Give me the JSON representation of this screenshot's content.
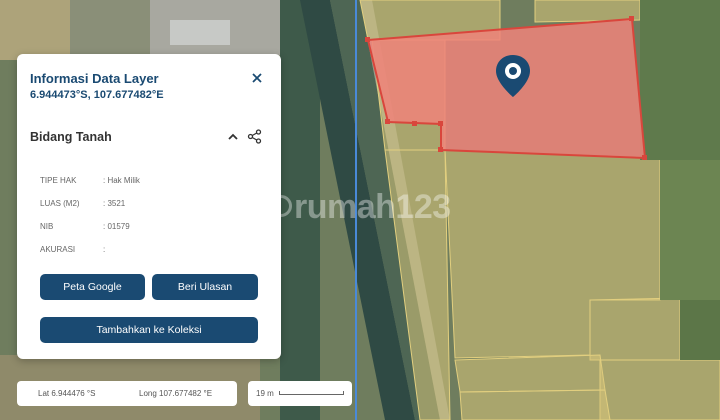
{
  "map": {
    "watermark": "rumah123"
  },
  "panel": {
    "title": "Informasi Data Layer",
    "coordinates": "6.944473°S, 107.677482°E",
    "section_title": "Bidang Tanah",
    "rows": [
      {
        "label": "TIPE HAK",
        "value": ": Hak Milik"
      },
      {
        "label": "LUAS (M2)",
        "value": ": 3521"
      },
      {
        "label": "NIB",
        "value": ": 01579"
      },
      {
        "label": "AKURASI",
        "value": ":"
      }
    ],
    "buttons": {
      "google": "Peta Google",
      "ulasan": "Beri Ulasan",
      "koleksi": "Tambahkan ke Koleksi"
    }
  },
  "coord_bar": {
    "lat": "Lat 6.944476 °S",
    "long": "Long 107.677482 °E"
  },
  "scale": {
    "label": "19 m"
  },
  "colors": {
    "primary": "#1a4a72",
    "parcel_fill": "#f0837a",
    "parcel_stroke": "#d9463c",
    "plot_fill": "#d8c67a"
  },
  "icons": [
    "close-icon",
    "chevron-up-icon",
    "share-icon",
    "location-pin-icon"
  ]
}
